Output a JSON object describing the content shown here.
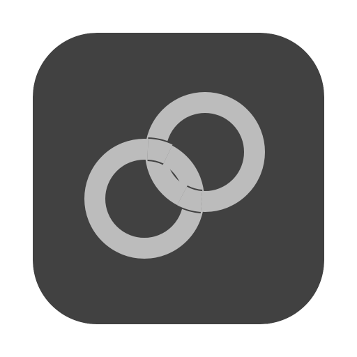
{
  "app_icon": {
    "icon": "interlocking-rings-icon",
    "colors": {
      "tile": "#414141",
      "rings": "#bcbcbc"
    }
  }
}
